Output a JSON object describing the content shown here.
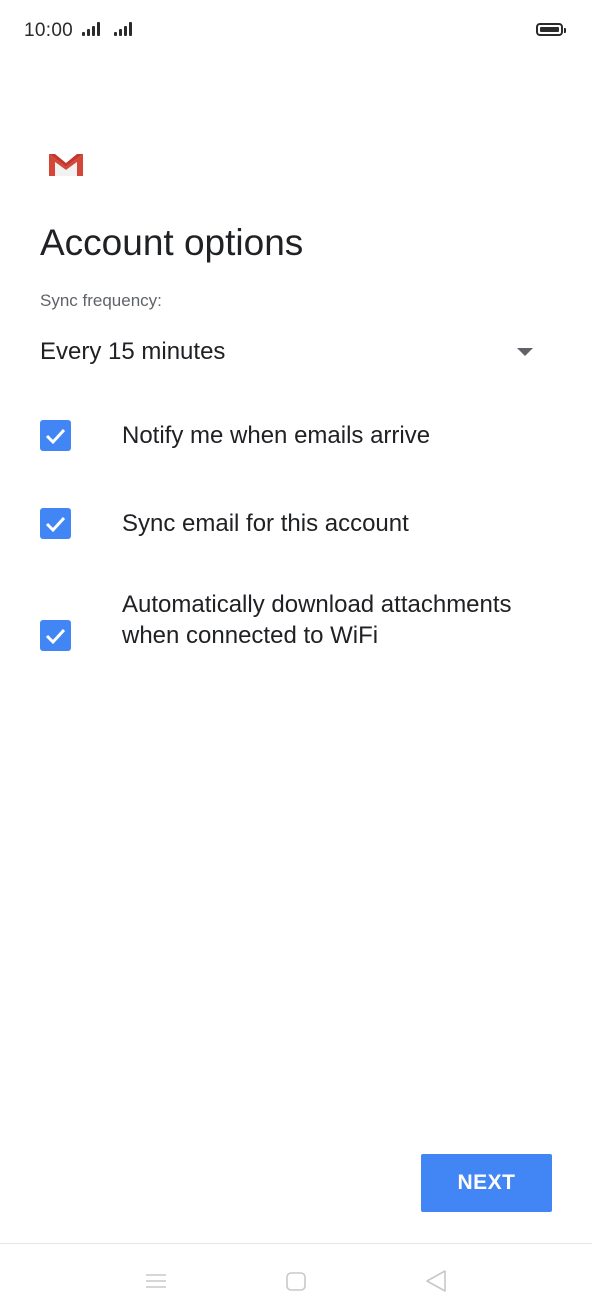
{
  "status_bar": {
    "time": "10:00"
  },
  "app": {
    "logo_icon": "gmail-m-icon"
  },
  "page": {
    "title": "Account options",
    "sync_label": "Sync frequency:",
    "sync_value": "Every 15 minutes"
  },
  "options": [
    {
      "label": "Notify me when emails arrive",
      "checked": true
    },
    {
      "label": "Sync email for this account",
      "checked": true
    },
    {
      "label": "Automatically download attachments when connected to WiFi",
      "checked": true
    }
  ],
  "actions": {
    "next_label": "NEXT"
  },
  "colors": {
    "accent": "#4285f4",
    "gmail_red": "#d44638"
  },
  "nav": {
    "icons": [
      "menu-icon",
      "home-icon",
      "back-icon"
    ]
  }
}
